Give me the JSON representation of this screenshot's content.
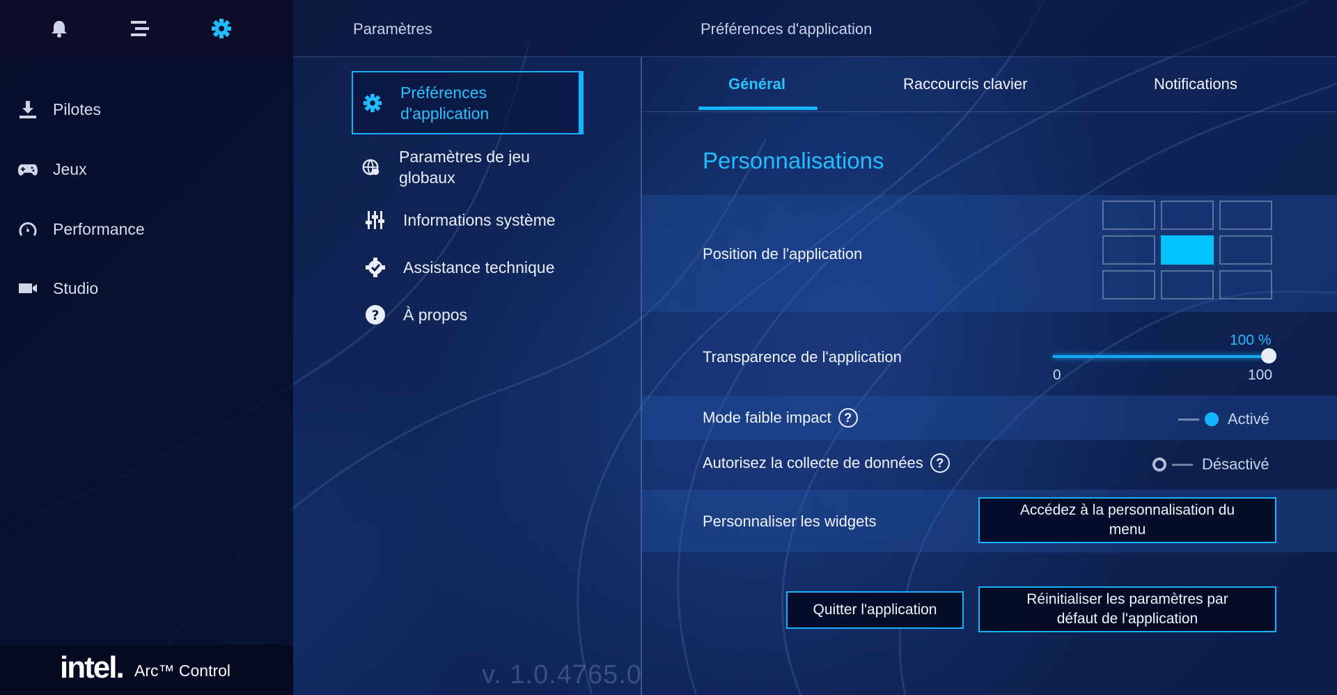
{
  "sidebar": {
    "top_icons": [
      "bell-icon",
      "menu-icon",
      "gear-icon"
    ],
    "items": [
      {
        "label": "Pilotes",
        "icon": "download-icon"
      },
      {
        "label": "Jeux",
        "icon": "gamepad-icon"
      },
      {
        "label": "Performance",
        "icon": "gauge-icon"
      },
      {
        "label": "Studio",
        "icon": "camera-icon"
      }
    ],
    "brand": {
      "logo": "intel.",
      "product": "Arc™ Control"
    }
  },
  "header": {
    "section": "Paramètres",
    "page": "Préférences d'application"
  },
  "settings_menu": {
    "items": [
      {
        "label_line1": "Préférences",
        "label_line2": "d'application",
        "icon": "gear-icon",
        "active": true
      },
      {
        "label_line1": "Paramètres de jeu",
        "label_line2": "globaux",
        "icon": "globe-gear-icon",
        "active": false
      },
      {
        "label_line1": "Informations système",
        "label_line2": "",
        "icon": "sliders-icon",
        "active": false
      },
      {
        "label_line1": "Assistance technique",
        "label_line2": "",
        "icon": "gear-check-icon",
        "active": false
      },
      {
        "label_line1": "À propos",
        "label_line2": "",
        "icon": "question-icon",
        "active": false
      }
    ],
    "version": "v. 1.0.4765.0"
  },
  "tabs": [
    {
      "label": "Général",
      "active": true
    },
    {
      "label": "Raccourcis clavier",
      "active": false
    },
    {
      "label": "Notifications",
      "active": false
    }
  ],
  "content": {
    "section_title": "Personnalisations",
    "position": {
      "label": "Position de l'application",
      "selected_cell": 4
    },
    "transparency": {
      "label": "Transparence de l'application",
      "value_label": "100 %",
      "value": 100,
      "min": "0",
      "max": "100"
    },
    "low_impact": {
      "label": "Mode faible impact",
      "state": "Activé",
      "on": true
    },
    "data_collection": {
      "label": "Autorisez la collecte de données",
      "state": "Désactivé",
      "on": false
    },
    "widgets": {
      "label": "Personnaliser les widgets",
      "button_line1": "Accédez à la personnalisation du",
      "button_line2": "menu"
    },
    "quit_button": "Quitter l'application",
    "reset_button_line1": "Réinitialiser les paramètres par",
    "reset_button_line2": "défaut de l'application"
  },
  "colors": {
    "accent": "#16b4ff",
    "sidebar": "#060c26",
    "background": "#0c1a3c"
  }
}
